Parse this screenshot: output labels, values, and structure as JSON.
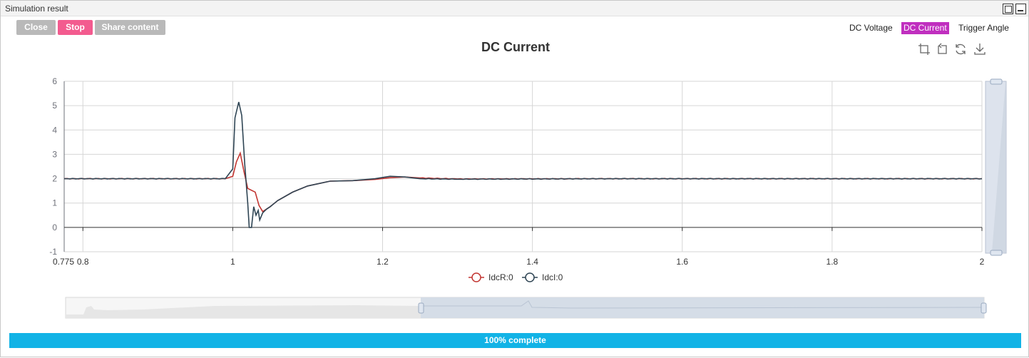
{
  "window": {
    "title": "Simulation result"
  },
  "toolbar": {
    "close_label": "Close",
    "stop_label": "Stop",
    "share_label": "Share content"
  },
  "tabs": [
    {
      "label": "DC Voltage",
      "active": false
    },
    {
      "label": "DC Current",
      "active": true
    },
    {
      "label": "Trigger Angle",
      "active": false
    }
  ],
  "toolbox_icons": [
    "zoom-select-icon",
    "zoom-reset-icon",
    "restore-icon",
    "download-icon"
  ],
  "progress": {
    "label": "100% complete",
    "value": 100
  },
  "chart_data": {
    "type": "line",
    "title": "DC Current",
    "xlim": [
      0.775,
      2
    ],
    "ylim": [
      -1,
      6
    ],
    "x_ticks": [
      0.775,
      0.8,
      1,
      1.2,
      1.4,
      1.6,
      1.8,
      2
    ],
    "x_tick_labels": [
      "0.775",
      "0.8",
      "1",
      "1.2",
      "1.4",
      "1.6",
      "1.8",
      "2"
    ],
    "y_ticks": [
      -1,
      0,
      1,
      2,
      3,
      4,
      5,
      6
    ],
    "y_tick_labels": [
      "-1",
      "0",
      "1",
      "2",
      "3",
      "4",
      "5",
      "6"
    ],
    "grid": true,
    "legend_position": "bottom-center",
    "series": [
      {
        "name": "IdcR:0",
        "color": "#c23531",
        "x": [
          0.775,
          0.99,
          1.0,
          1.005,
          1.01,
          1.015,
          1.02,
          1.03,
          1.035,
          1.04,
          1.05,
          1.06,
          1.08,
          1.1,
          1.13,
          1.16,
          1.19,
          1.21,
          1.23,
          1.25,
          1.3,
          1.5,
          2.0
        ],
        "y": [
          2.0,
          2.0,
          2.1,
          2.7,
          3.05,
          2.3,
          1.6,
          1.45,
          0.9,
          0.65,
          0.85,
          1.1,
          1.45,
          1.7,
          1.9,
          1.92,
          1.97,
          2.04,
          2.07,
          2.03,
          1.99,
          2.0,
          2.0
        ]
      },
      {
        "name": "IdcI:0",
        "color": "#2f4554",
        "x": [
          0.775,
          0.99,
          1.0,
          1.003,
          1.008,
          1.012,
          1.016,
          1.02,
          1.022,
          1.025,
          1.028,
          1.031,
          1.034,
          1.036,
          1.04,
          1.045,
          1.05,
          1.06,
          1.08,
          1.1,
          1.13,
          1.16,
          1.19,
          1.21,
          1.23,
          1.25,
          1.3,
          1.5,
          2.0
        ],
        "y": [
          2.0,
          2.0,
          2.4,
          4.5,
          5.15,
          4.6,
          2.6,
          1.0,
          0.0,
          0.0,
          0.85,
          0.5,
          0.7,
          0.3,
          0.6,
          0.75,
          0.85,
          1.1,
          1.45,
          1.7,
          1.9,
          1.92,
          2.0,
          2.1,
          2.07,
          2.0,
          1.98,
          2.0,
          2.0
        ]
      }
    ]
  }
}
